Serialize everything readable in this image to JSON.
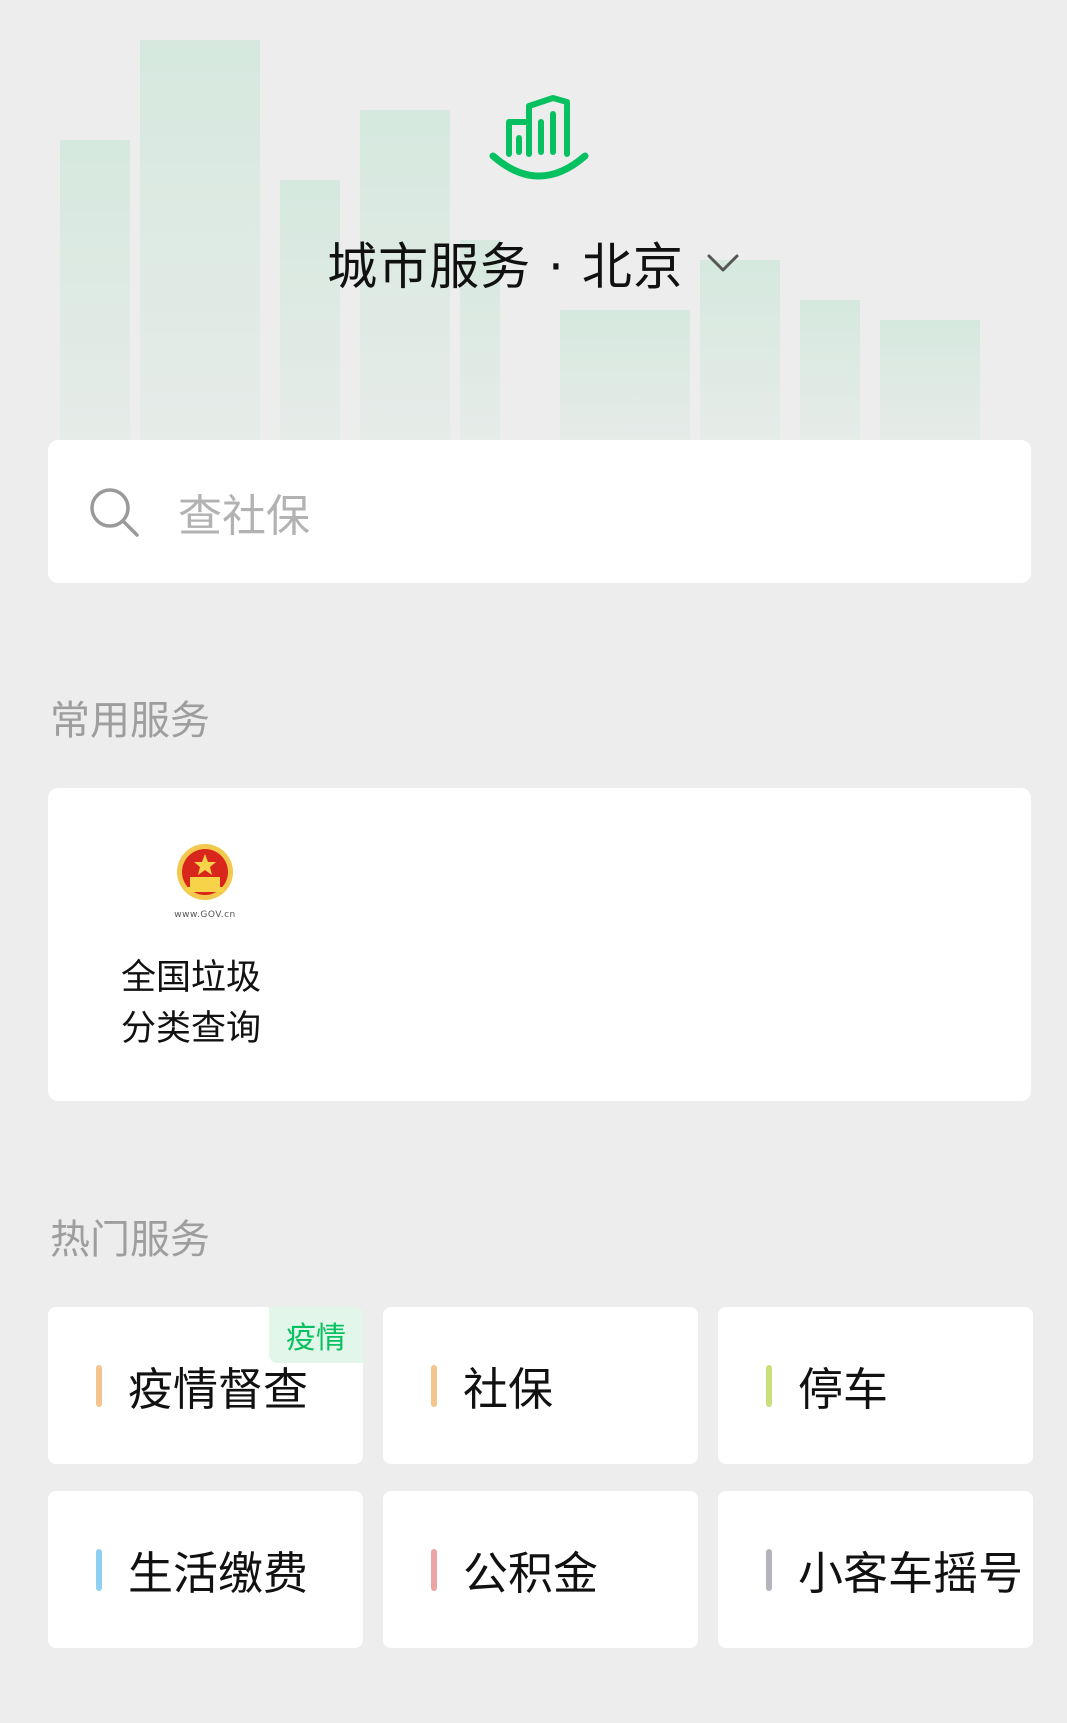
{
  "header": {
    "title": "城市服务 · 北京",
    "logo_icon": "city-building-icon",
    "dropdown_icon": "chevron-down-icon"
  },
  "search": {
    "placeholder": "查社保",
    "icon": "search-icon"
  },
  "common_services": {
    "section_label": "常用服务",
    "items": [
      {
        "label": "全国垃圾\n分类查询",
        "icon": "national-emblem-icon",
        "icon_caption": "www.GOV.cn"
      }
    ]
  },
  "hot_services": {
    "section_label": "热门服务",
    "items": [
      {
        "label": "疫情督查",
        "bar_color": "#f3c48d",
        "badge": "疫情"
      },
      {
        "label": "社保",
        "bar_color": "#f3c48d"
      },
      {
        "label": "停车",
        "bar_color": "#c8e07c"
      },
      {
        "label": "生活缴费",
        "bar_color": "#8fd0f2"
      },
      {
        "label": "公积金",
        "bar_color": "#eda4a4"
      },
      {
        "label": "小客车摇号",
        "bar_color": "#b4b4bc"
      }
    ]
  },
  "colors": {
    "accent": "#07c160",
    "background": "#ededed"
  }
}
